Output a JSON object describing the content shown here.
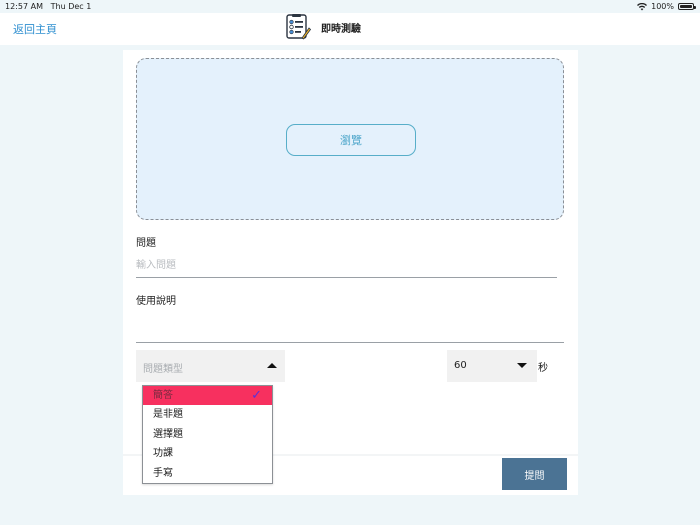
{
  "status_bar": {
    "time": "12:57 AM",
    "date": "Thu Dec 1",
    "battery": "100%",
    "battery_level": 1.0
  },
  "nav": {
    "back_label": "返回主頁",
    "title": "即時測驗"
  },
  "upload": {
    "browse_label": "瀏覽"
  },
  "question": {
    "label": "問題",
    "placeholder": "輸入問題"
  },
  "instructions": {
    "label": "使用說明"
  },
  "question_type": {
    "placeholder": "問題類型"
  },
  "time_limit": {
    "value": "60",
    "unit": "秒"
  },
  "submit_label": "提問",
  "dropdown": {
    "items": [
      {
        "label": "簡答",
        "selected": true
      },
      {
        "label": "是非題",
        "selected": false
      },
      {
        "label": "選擇題",
        "selected": false
      },
      {
        "label": "功課",
        "selected": false
      },
      {
        "label": "手寫",
        "selected": false
      }
    ]
  },
  "colors": {
    "accent": "#2f8fd0",
    "selected_row": "#f7305f",
    "submit": "#4b7394",
    "check": "#5a30d8"
  }
}
